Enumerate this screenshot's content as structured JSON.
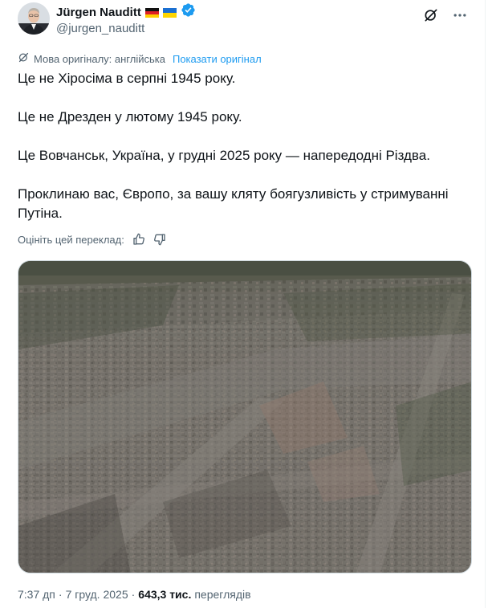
{
  "author": {
    "display_name": "Jürgen Nauditt",
    "handle": "@jurgen_nauditt",
    "flags": [
      "germany-flag",
      "ukraine-flag"
    ],
    "verified": true
  },
  "translation": {
    "original_language": "Мова оригіналу: англійська",
    "show_original": "Показати оригінал"
  },
  "tweet": {
    "lines": [
      "Це не Хіросіма в серпні 1945 року.",
      "Це не Дрезден у лютому 1945 року.",
      "Це Вовчанськ, Україна, у грудні 2025 року — напередодні Різдва.",
      "Проклинаю вас, Європо, за вашу кляту боягузливість у стримуванні Путіна."
    ]
  },
  "rate": {
    "label": "Оцініть цей переклад:"
  },
  "meta": {
    "time": "7:37 дп",
    "separator": "·",
    "date": "7 груд. 2025",
    "views_count": "643,3 тис.",
    "views_label": "переглядів"
  },
  "colors": {
    "accent": "#1d9bf0",
    "secondary_text": "#536471",
    "primary_text": "#0f1419"
  }
}
